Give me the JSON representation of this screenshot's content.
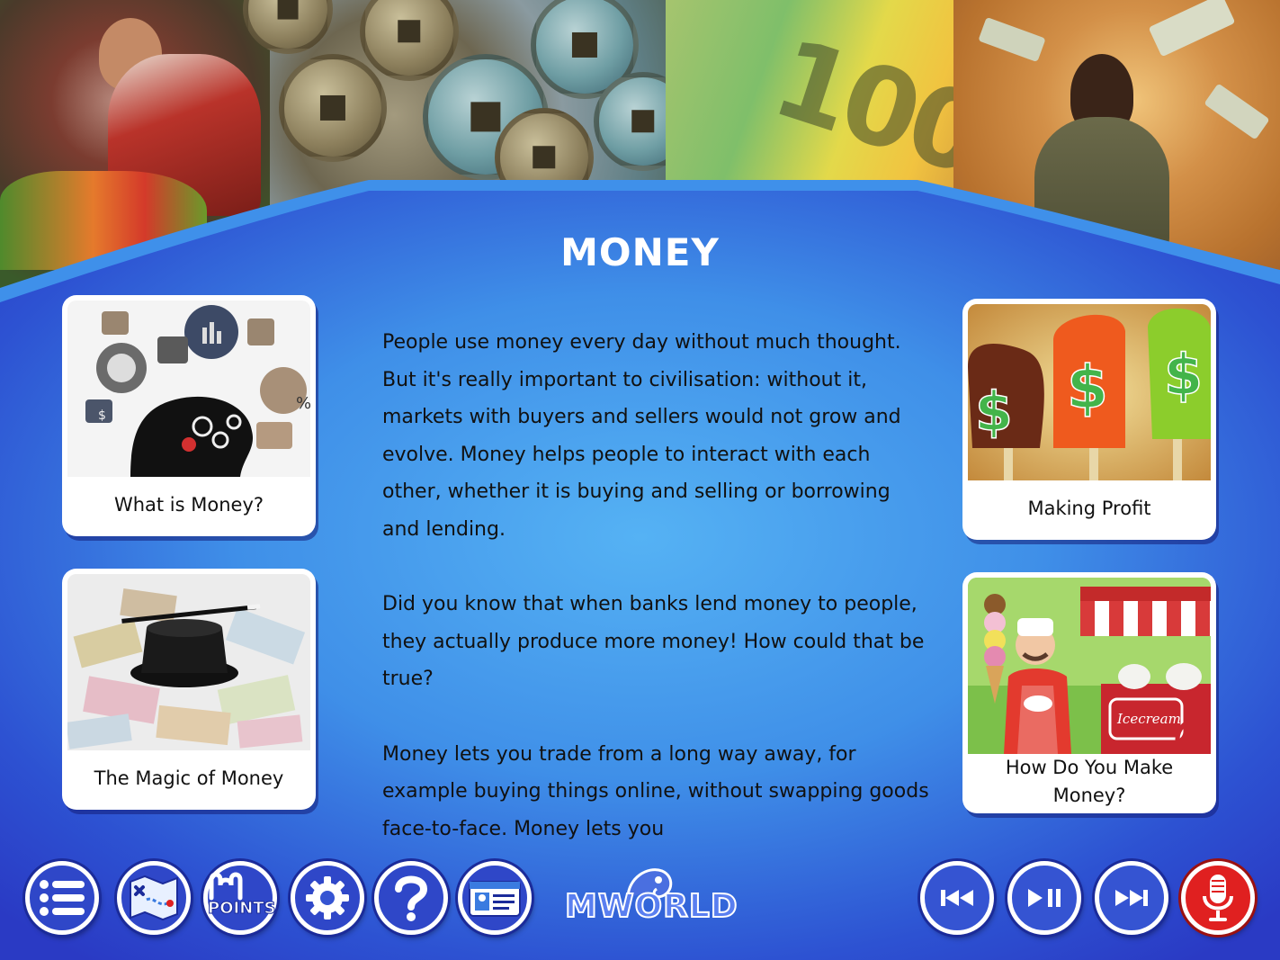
{
  "page": {
    "title": "MONEY"
  },
  "article": {
    "paragraphs": [
      "People use money every day without much thought.  But it's really important to civilisation: without it, markets with buyers and sellers would not grow and evolve. Money helps people to interact with each other, whether it is buying and selling or borrowing and lending.",
      "Did you know that when banks lend money to people, they actually produce more money!  How could that be true?",
      "Money lets you trade from a long way away, for example buying things online, without swapping goods face-to-face.  Money lets you"
    ]
  },
  "cards": {
    "what": {
      "label": "What is Money?"
    },
    "magic": {
      "label": "The Magic of Money"
    },
    "profit": {
      "label": "Making Profit"
    },
    "make": {
      "label": "How Do You Make Money?"
    }
  },
  "toolbar": {
    "points_label": "POINTS",
    "logo_text": "MWORLD"
  },
  "illustration_text": {
    "note_denomination": "100",
    "icecream_sign": "Icecream",
    "cart_sign": "Icecream"
  },
  "colors": {
    "background_blue": "#2b3cc8",
    "panel_light_blue": "#4fa8f0",
    "button_blue": "#2f47c8",
    "record_red": "#e02020",
    "title_white": "#ffffff"
  },
  "icons": {
    "menu": "list-icon",
    "map": "map-icon",
    "points": "points-badge-icon",
    "settings": "gear-icon",
    "help": "question-icon",
    "profile": "id-card-icon",
    "previous": "skip-back-icon",
    "play_pause": "play-pause-icon",
    "next": "skip-forward-icon",
    "record": "microphone-icon"
  }
}
